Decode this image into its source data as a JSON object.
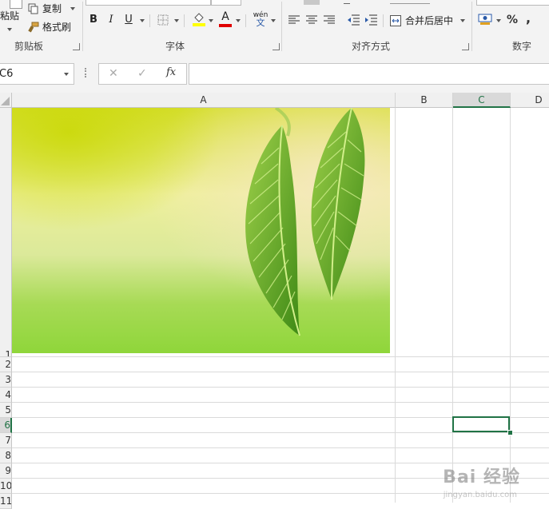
{
  "ribbon": {
    "clipboard": {
      "paste_label": "粘贴",
      "copy_label": "复制",
      "format_painter_label": "格式刷",
      "group_label": "剪贴板"
    },
    "font": {
      "bold": "B",
      "italic": "I",
      "underline": "U",
      "font_color_letter": "A",
      "phonetic_top": "wén",
      "phonetic_bottom": "文",
      "group_label": "字体",
      "fill_color": "#ffff00",
      "font_color": "#e00000"
    },
    "alignment": {
      "merge_label": "合并后居中",
      "group_label": "对齐方式"
    },
    "number": {
      "percent": "%",
      "comma": ",",
      "group_label": "数字"
    }
  },
  "formula_bar": {
    "name_box": "C6",
    "cancel_symbol": "✕",
    "enter_symbol": "✓",
    "function_symbol": "fx",
    "formula_value": ""
  },
  "grid": {
    "columns": [
      "A",
      "B",
      "C",
      "D"
    ],
    "selected_column": "C",
    "rows": [
      "1",
      "2",
      "3",
      "4",
      "5",
      "6",
      "7",
      "8",
      "9",
      "10",
      "11"
    ],
    "selected_row": "6",
    "active_cell": "C6"
  },
  "picture": {
    "description_icon": "green-leaves-photo"
  },
  "watermark": {
    "text": "Bai 经验",
    "sub": "jingyan.baidu.com"
  }
}
